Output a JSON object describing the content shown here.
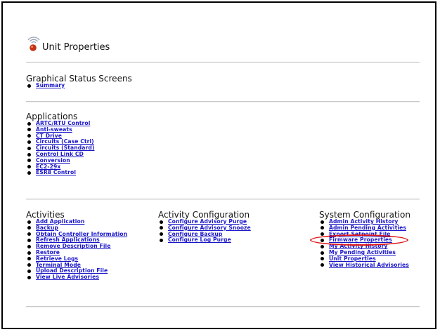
{
  "unit_properties": {
    "title": "Unit Properties",
    "icon": "wifi-globe-icon"
  },
  "graphical_status": {
    "title": "Graphical Status Screens",
    "items": [
      "Summary"
    ]
  },
  "applications": {
    "title": "Applications",
    "items": [
      "ARTC/RTU Control",
      "Anti-sweats",
      "CT Drive",
      "Circuits (Case Ctrl)",
      "Circuits (Standard)",
      "Control Link CD",
      "Conversion",
      "EC2-29x",
      "ESR8 Control"
    ]
  },
  "activities": {
    "title": "Activities",
    "items": [
      "Add Application",
      "Backup",
      "Obtain Controller Information",
      "Refresh Applications",
      "Remove Description File",
      "Restore",
      "Retrieve Logs",
      "Terminal Mode",
      "Upload Description File",
      "View Live Advisories"
    ]
  },
  "activity_configuration": {
    "title": "Activity Configuration",
    "items": [
      "Configure Advisory Purge",
      "Configure Advisory Snooze",
      "Configure Backup",
      "Configure Log Purge"
    ]
  },
  "system_configuration": {
    "title": "System Configuration",
    "items": [
      "Admin Activity History",
      "Admin Pending Activities",
      "Export Setpoint File",
      "Firmware Properties",
      "My Activity History",
      "My Pending Activities",
      "Unit Properties",
      "View Historical Advisories"
    ]
  },
  "colors": {
    "link": "#1a16c8",
    "highlight": "#e01818",
    "rule": "#c8c8c8"
  }
}
